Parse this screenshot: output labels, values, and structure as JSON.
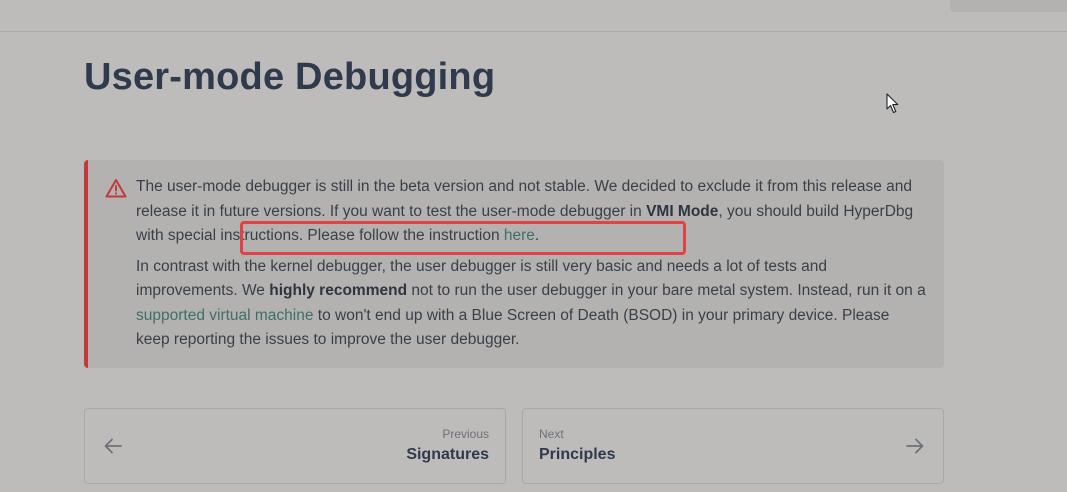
{
  "page": {
    "title": "User-mode Debugging"
  },
  "callout": {
    "icon": "warning-triangle-icon",
    "accent_color": "#c0393b",
    "p1_text1": "The user-mode debugger is still in the beta version and not stable. We decided to exclude it from this release and release it in future versions. If you want to test the user-mode debugger in ",
    "p1_bold": "VMI Mode",
    "p1_text2": ", you should build HyperDbg with special instructions. Please follow the instruction ",
    "p1_link": "here",
    "p1_text3": ".",
    "p2_text1": "In contrast with the kernel debugger, the user debugger is still very basic and needs a lot of tests and improvements. We ",
    "p2_bold": "highly recommend",
    "p2_text2": " not to run the user debugger in your bare metal system. Instead, run it on a ",
    "p2_link": "supported virtual machine",
    "p2_text3": " to won't end up with a Blue Screen of Death (BSOD) in your primary device. Please keep reporting the issues to improve the user debugger."
  },
  "annotation": {
    "highlight_color": "#e34245"
  },
  "pagination": {
    "prev_caption": "Previous",
    "prev_title": "Signatures",
    "prev_icon": "arrow-left-icon",
    "next_caption": "Next",
    "next_title": "Principles",
    "next_icon": "arrow-right-icon"
  }
}
